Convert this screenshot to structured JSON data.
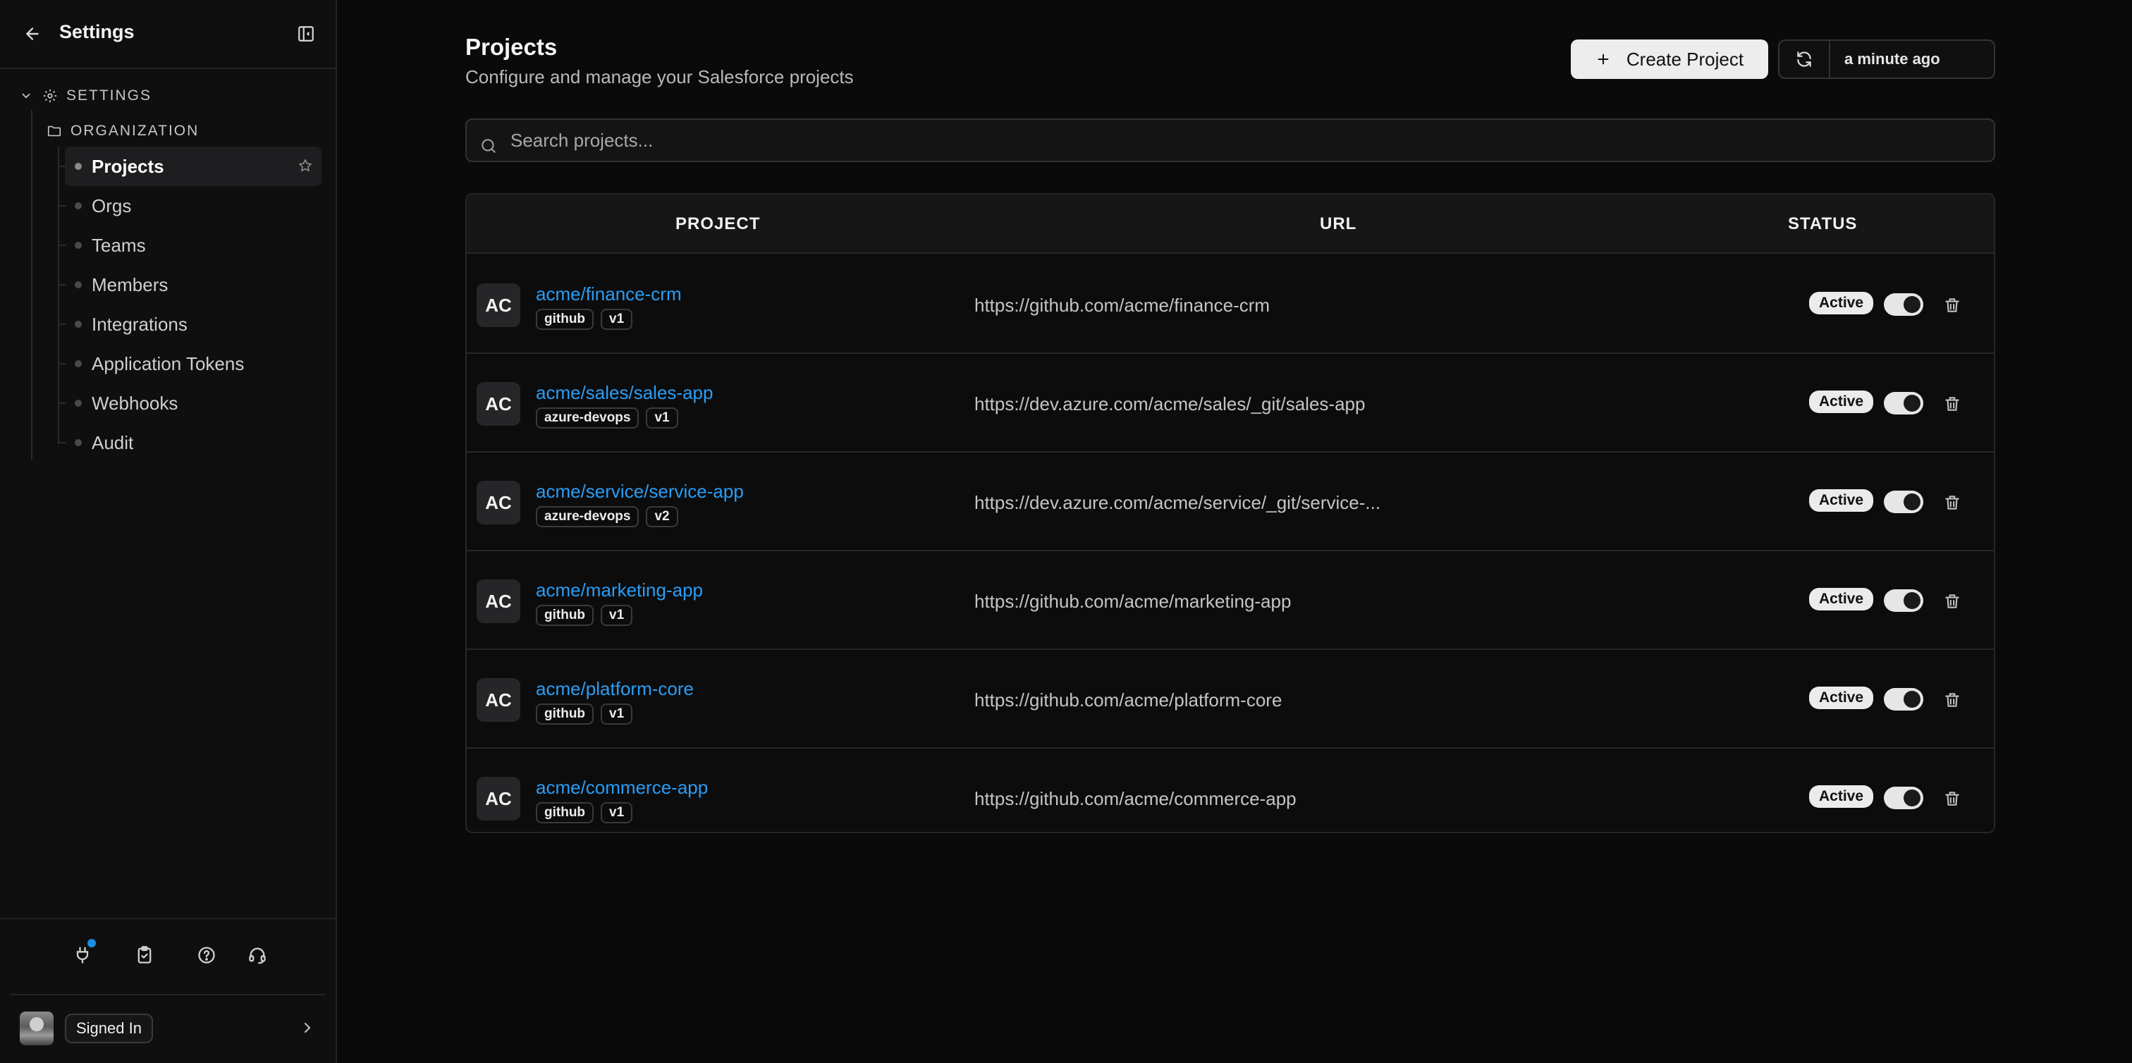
{
  "sidebar": {
    "title": "Settings",
    "group_settings": "SETTINGS",
    "group_org": "ORGANIZATION",
    "items": [
      {
        "label": "Projects",
        "active": true
      },
      {
        "label": "Orgs"
      },
      {
        "label": "Teams"
      },
      {
        "label": "Members"
      },
      {
        "label": "Integrations"
      },
      {
        "label": "Application Tokens"
      },
      {
        "label": "Webhooks"
      },
      {
        "label": "Audit"
      }
    ],
    "tools": [
      "plug-icon",
      "clipboard-check-icon",
      "help-circle-icon",
      "headset-icon"
    ],
    "user": {
      "status": "Signed In"
    }
  },
  "header": {
    "title": "Projects",
    "subtitle": "Configure and manage your Salesforce projects",
    "create_label": "Create Project",
    "refresh_time": "a minute ago"
  },
  "search": {
    "placeholder": "Search projects..."
  },
  "table": {
    "columns": {
      "project": "PROJECT",
      "url": "URL",
      "status": "STATUS"
    },
    "rows": [
      {
        "avatar": "AC",
        "name": "acme/finance-crm",
        "provider": "github",
        "version": "v1",
        "url": "https://github.com/acme/finance-crm",
        "status": "Active"
      },
      {
        "avatar": "AC",
        "name": "acme/sales/sales-app",
        "provider": "azure-devops",
        "version": "v1",
        "url": "https://dev.azure.com/acme/sales/_git/sales-app",
        "status": "Active"
      },
      {
        "avatar": "AC",
        "name": "acme/service/service-app",
        "provider": "azure-devops",
        "version": "v2",
        "url": "https://dev.azure.com/acme/service/_git/service-...",
        "status": "Active"
      },
      {
        "avatar": "AC",
        "name": "acme/marketing-app",
        "provider": "github",
        "version": "v1",
        "url": "https://github.com/acme/marketing-app",
        "status": "Active"
      },
      {
        "avatar": "AC",
        "name": "acme/platform-core",
        "provider": "github",
        "version": "v1",
        "url": "https://github.com/acme/platform-core",
        "status": "Active"
      },
      {
        "avatar": "AC",
        "name": "acme/commerce-app",
        "provider": "github",
        "version": "v1",
        "url": "https://github.com/acme/commerce-app",
        "status": "Active"
      }
    ]
  },
  "colors": {
    "accent_link": "#2a9df4",
    "notification": "#1d8fe0",
    "background": "#0a0a0b"
  }
}
